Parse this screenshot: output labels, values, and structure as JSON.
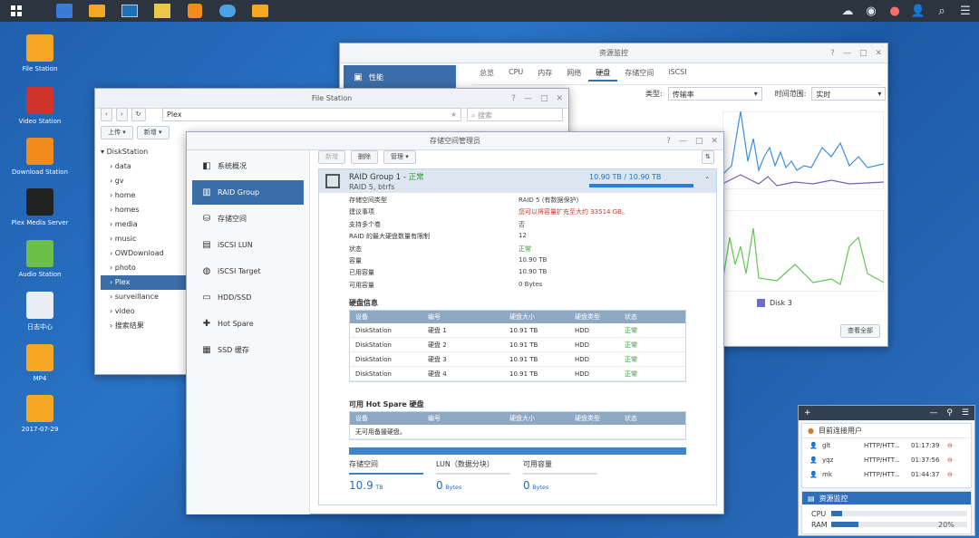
{
  "taskbar": {
    "items": [
      "main-menu",
      "file-station",
      "dsm-help",
      "resource-monitor",
      "photo",
      "download-station",
      "cloud",
      "file-station-2"
    ]
  },
  "desktop": [
    {
      "label": "File Station",
      "color": "#f5a623",
      "icon": "folder-search-icon"
    },
    {
      "label": "Video Station",
      "color": "#d0332b",
      "icon": "film-icon"
    },
    {
      "label": "Download Station",
      "color": "#f08c1c",
      "icon": "download-arrow-icon"
    },
    {
      "label": "Plex Media Server",
      "color": "#222",
      "icon": "plex-chevron-icon"
    },
    {
      "label": "Audio Station",
      "color": "#6cc04a",
      "icon": "music-note-icon"
    },
    {
      "label": "日志中心",
      "color": "#e9eef5",
      "icon": "log-center-icon"
    },
    {
      "label": "MP4",
      "color": "#f5a623",
      "icon": "folder-icon"
    },
    {
      "label": "2017-07-29",
      "color": "#f5a623",
      "icon": "folder-icon"
    }
  ],
  "resmon": {
    "title": "资源监控",
    "nav": "性能",
    "tabs": [
      "总览",
      "CPU",
      "内存",
      "网络",
      "硬盘",
      "存储空间",
      "iSCSI"
    ],
    "active_tab": "硬盘",
    "type_label": "类型:",
    "type_value": "传输率",
    "range_label": "时间范围:",
    "range_value": "实时",
    "legend": "Disk 3",
    "view_all": "查看全部"
  },
  "filestation": {
    "title": "File Station",
    "path": "Plex",
    "search_placeholder": "搜索",
    "upload": "上传",
    "new": "新增",
    "root": "DiskStation",
    "folders": [
      "data",
      "gv",
      "home",
      "homes",
      "media",
      "music",
      "OWDownload",
      "photo",
      "Plex",
      "surveillance",
      "video",
      "搜索结果"
    ],
    "active_folder": "Plex"
  },
  "storage": {
    "title": "存储空间管理员",
    "nav": [
      "系统概况",
      "RAID Group",
      "存储空间",
      "iSCSI LUN",
      "iSCSI Target",
      "HDD/SSD",
      "Hot Spare",
      "SSD 缓存"
    ],
    "active_nav": "RAID Group",
    "toolbar": {
      "create": "新增",
      "delete": "删除",
      "manage": "管理"
    },
    "raid": {
      "name": "RAID Group 1",
      "status": "正常",
      "type": "RAID 5, btrfs",
      "capacity": "10.90 TB / 10.90 TB",
      "usage_percent": 100
    },
    "props": [
      [
        "存储空间类型",
        "RAID 5 (有数据保护)"
      ],
      [
        "建议事项",
        "您可以将容量扩充至大约 33514 GB。"
      ],
      [
        "支持多个卷",
        "否"
      ],
      [
        "RAID 的最大硬盘数量有限制",
        "12"
      ],
      [
        "状态",
        "正常"
      ],
      [
        "容量",
        "10.90 TB"
      ],
      [
        "已用容量",
        "10.90 TB"
      ],
      [
        "可用容量",
        "0 Bytes"
      ]
    ],
    "disk_info_title": "硬盘信息",
    "disk_headers": [
      "设备",
      "编号",
      "硬盘大小",
      "硬盘类型",
      "状态"
    ],
    "disks": [
      [
        "DiskStation",
        "硬盘 1",
        "10.91 TB",
        "HDD",
        "正常"
      ],
      [
        "DiskStation",
        "硬盘 2",
        "10.91 TB",
        "HDD",
        "正常"
      ],
      [
        "DiskStation",
        "硬盘 3",
        "10.91 TB",
        "HDD",
        "正常"
      ],
      [
        "DiskStation",
        "硬盘 4",
        "10.91 TB",
        "HDD",
        "正常"
      ]
    ],
    "hotspare_title": "可用 Hot Spare 硬盘",
    "hotspare_empty": "无可用备援硬盘。",
    "summary": [
      {
        "label": "存储空间",
        "value": "10.9",
        "unit": "TB"
      },
      {
        "label": "LUN（数据分块）",
        "value": "0",
        "unit": "Bytes"
      },
      {
        "label": "可用容量",
        "value": "0",
        "unit": "Bytes"
      }
    ]
  },
  "widget": {
    "users_title": "目前连接用户",
    "users": [
      [
        "glt",
        "HTTP/HTT...",
        "01:17:39"
      ],
      [
        "yqz",
        "HTTP/HTT...",
        "01:37:56"
      ],
      [
        "mk",
        "HTTP/HTT...",
        "01:44:37"
      ]
    ],
    "monitor_title": "资源监控",
    "cpu": "CPU",
    "ram": "RAM",
    "ram_pct": "20%"
  }
}
